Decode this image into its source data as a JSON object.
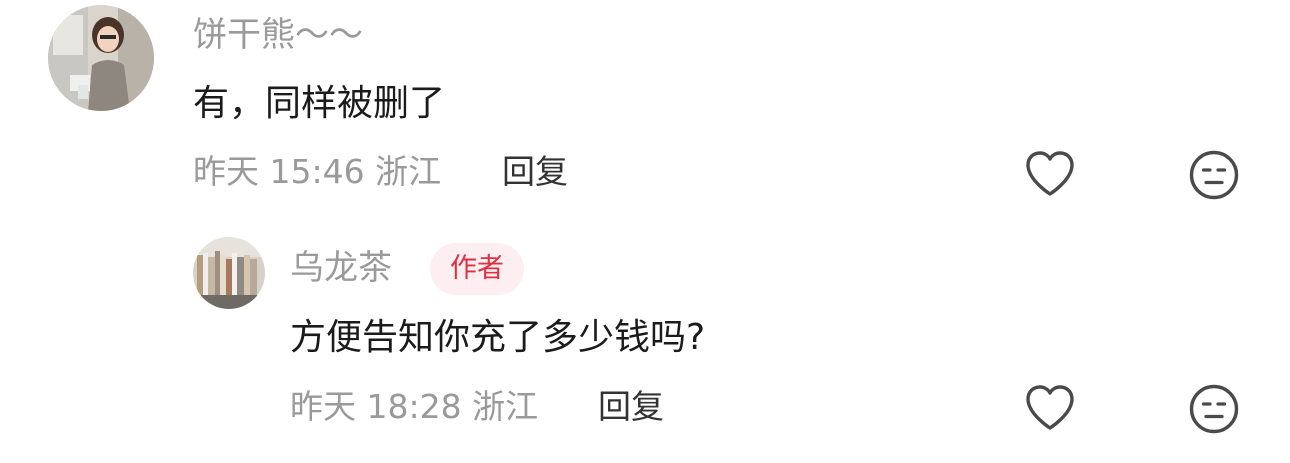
{
  "comments": [
    {
      "username": "饼干熊～～",
      "text": "有，同样被删了",
      "time": "昨天 15:46 浙江",
      "reply_label": "回复",
      "avatar_icon": "avatar-illustrated-girl-icon"
    }
  ],
  "replies": [
    {
      "username": "乌龙茶",
      "badge": "作者",
      "text": "方便告知你充了多少钱吗?",
      "time": "昨天 18:28 浙江",
      "reply_label": "回复",
      "avatar_icon": "avatar-bookshelf-icon"
    }
  ],
  "colors": {
    "meta_gray": "#9a9a9a",
    "text": "#1b1b1b",
    "badge_text": "#e0303f",
    "badge_bg": "#fdeff1"
  }
}
